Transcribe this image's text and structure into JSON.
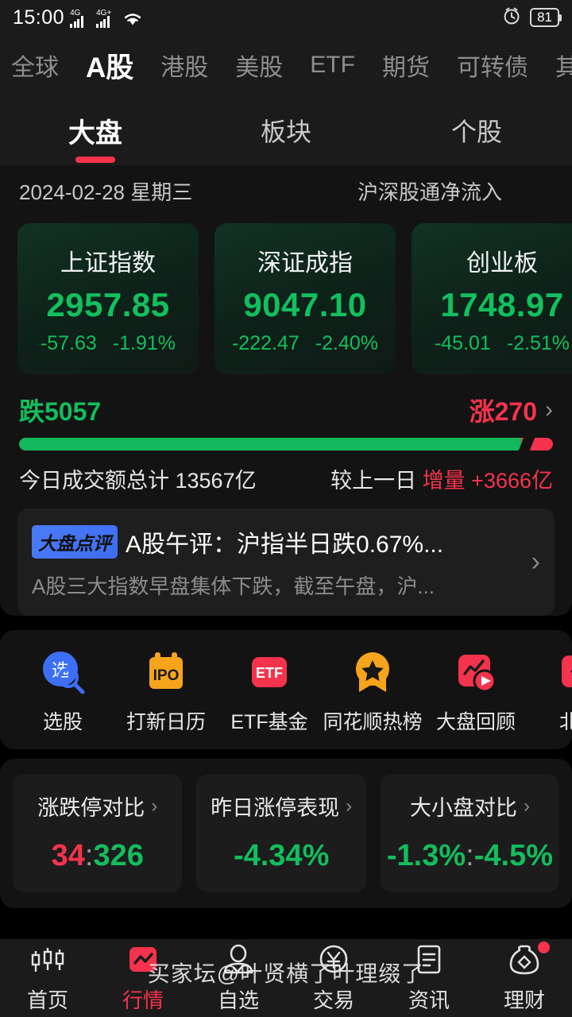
{
  "status_bar": {
    "time": "15:00",
    "network_1": "4G",
    "network_2": "4G+",
    "wifi_icon": "wifi-icon",
    "alarm_icon": "alarm-icon",
    "battery_level": "81"
  },
  "market_tabs": [
    {
      "label": "全球",
      "active": false
    },
    {
      "label": "A股",
      "active": true
    },
    {
      "label": "港股",
      "active": false
    },
    {
      "label": "美股",
      "active": false
    },
    {
      "label": "ETF",
      "active": false
    },
    {
      "label": "期货",
      "active": false
    },
    {
      "label": "可转债",
      "active": false
    },
    {
      "label": "其他",
      "active": false
    }
  ],
  "sub_tabs": [
    {
      "label": "大盘",
      "active": true
    },
    {
      "label": "板块",
      "active": false
    },
    {
      "label": "个股",
      "active": false
    }
  ],
  "date_row": {
    "date": "2024-02-28 星期三",
    "flow_label": "沪深股通净流入"
  },
  "indices": [
    {
      "name": "上证指数",
      "value": "2957.85",
      "change": "-57.63",
      "percent": "-1.91%"
    },
    {
      "name": "深证成指",
      "value": "9047.10",
      "change": "-222.47",
      "percent": "-2.40%"
    },
    {
      "name": "创业板",
      "value": "1748.97",
      "change": "-45.01",
      "percent": "-2.51%"
    }
  ],
  "advance_decline": {
    "down_label": "跌5057",
    "up_label": "涨270",
    "chevron": "chevron-right-icon",
    "down_count": 5057,
    "up_count": 270,
    "green_ratio_percent": 94
  },
  "volume": {
    "left_text": "今日成交额总计 13567亿",
    "right_prefix": "较上一日 ",
    "right_highlight": "增量 +3666亿"
  },
  "news": {
    "badge": "大盘点评",
    "title": "A股午评：沪指半日跌0.67%...",
    "desc": "A股三大指数早盘集体下跌，截至午盘，沪...",
    "chevron": "chevron-right-icon"
  },
  "quick_actions": [
    {
      "label": "选股",
      "icon": "stock-picker-icon"
    },
    {
      "label": "打新日历",
      "icon": "ipo-calendar-icon"
    },
    {
      "label": "ETF基金",
      "icon": "etf-fund-icon"
    },
    {
      "label": "同花顺热榜",
      "icon": "hot-list-star-icon"
    },
    {
      "label": "大盘回顾",
      "icon": "market-replay-icon"
    },
    {
      "label": "北交",
      "icon": "beijing-exchange-icon"
    }
  ],
  "stat_cards": [
    {
      "title": "涨跌停对比",
      "chevron": "chevron-right-icon",
      "left_value": "34",
      "separator": ":",
      "right_value": "326",
      "left_color": "red",
      "right_color": "green"
    },
    {
      "title": "昨日涨停表现",
      "chevron": "chevron-right-icon",
      "left_value": "-4.34%",
      "separator": "",
      "right_value": "",
      "left_color": "green",
      "right_color": "green"
    },
    {
      "title": "大小盘对比",
      "chevron": "chevron-right-icon",
      "left_value": "-1.3%",
      "separator": ":",
      "right_value": "-4.5%",
      "left_color": "green",
      "right_color": "green"
    }
  ],
  "bottom_nav": [
    {
      "label": "首页",
      "icon": "candlestick-icon",
      "active": false,
      "dot": false
    },
    {
      "label": "行情",
      "icon": "market-chart-icon",
      "active": true,
      "dot": false
    },
    {
      "label": "自选",
      "icon": "watchlist-person-icon",
      "active": false,
      "dot": false
    },
    {
      "label": "交易",
      "icon": "yuan-circle-icon",
      "active": false,
      "dot": false
    },
    {
      "label": "资讯",
      "icon": "document-icon",
      "active": false,
      "dot": false
    },
    {
      "label": "理财",
      "icon": "money-bag-icon",
      "active": false,
      "dot": true
    }
  ],
  "watermark": "买家坛@叶贤横了叶理缀了",
  "colors": {
    "up_red": "#f5334d",
    "down_green": "#13bd5d",
    "accent_blue": "#4a7bf7",
    "bg": "#000000",
    "panel": "#131313"
  }
}
